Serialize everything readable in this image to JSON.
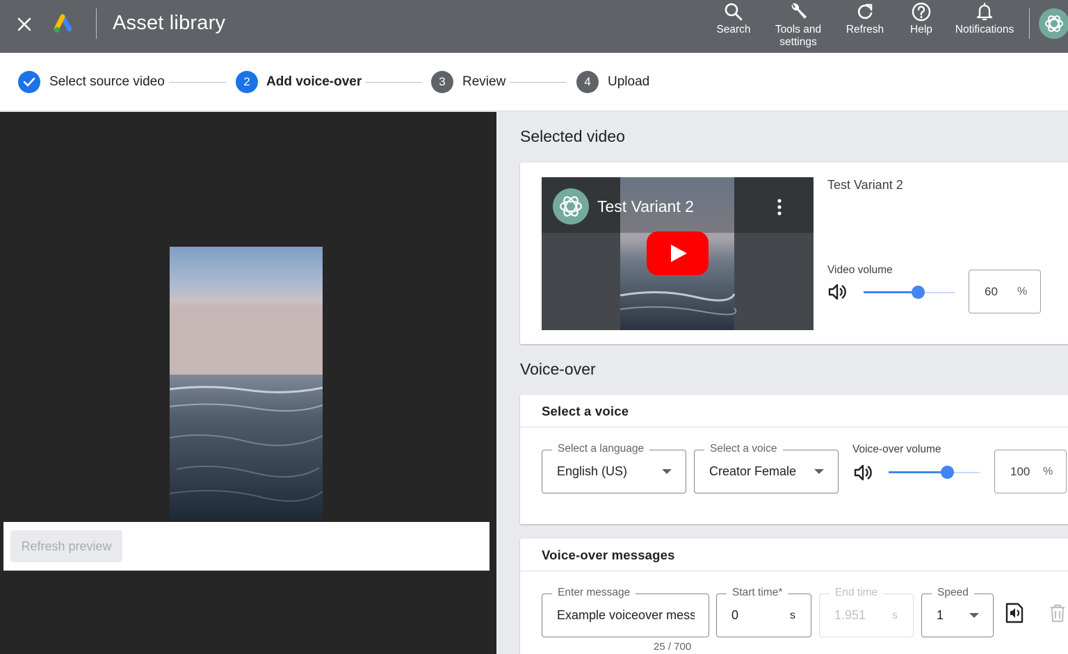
{
  "header": {
    "title": "Asset library",
    "actions": [
      {
        "label": "Search",
        "icon": "search-icon"
      },
      {
        "label": "Tools and settings",
        "icon": "wrench-icon"
      },
      {
        "label": "Refresh",
        "icon": "refresh-icon"
      },
      {
        "label": "Help",
        "icon": "help-icon"
      },
      {
        "label": "Notifications",
        "icon": "bell-icon"
      }
    ]
  },
  "stepper": {
    "steps": [
      {
        "number": "✓",
        "label": "Select source video",
        "state": "complete"
      },
      {
        "number": "2",
        "label": "Add voice-over",
        "state": "active"
      },
      {
        "number": "3",
        "label": "Review",
        "state": "pending"
      },
      {
        "number": "4",
        "label": "Upload",
        "state": "pending"
      }
    ]
  },
  "preview": {
    "refresh_label": "Refresh preview"
  },
  "selected_video": {
    "section_title": "Selected video",
    "player_title": "Test Variant 2",
    "name": "Test Variant 2",
    "volume_label": "Video volume",
    "volume_value": "60",
    "volume_unit": "%",
    "volume_level": 0.6
  },
  "voice_over": {
    "section_title": "Voice-over",
    "select_voice": {
      "title": "Select a voice",
      "language_label": "Select a language",
      "language_value": "English (US)",
      "voice_label": "Select a voice",
      "voice_value": "Creator Female",
      "volume_label": "Voice-over volume",
      "volume_value": "100",
      "volume_unit": "%",
      "volume_level": 1.0
    },
    "messages": {
      "title": "Voice-over messages",
      "message_label": "Enter message",
      "message_value": "Example voiceover message",
      "counter": "25 / 700",
      "start_label": "Start time*",
      "start_value": "0",
      "start_unit": "s",
      "end_label": "End time",
      "end_value": "1.951",
      "end_unit": "s",
      "speed_label": "Speed",
      "speed_value": "1"
    }
  },
  "colors": {
    "header_bg": "#5f6368",
    "accent": "#4285f4",
    "step_active": "#1a73e8",
    "step_pending": "#5f6368",
    "yt_red": "#ff0000"
  }
}
